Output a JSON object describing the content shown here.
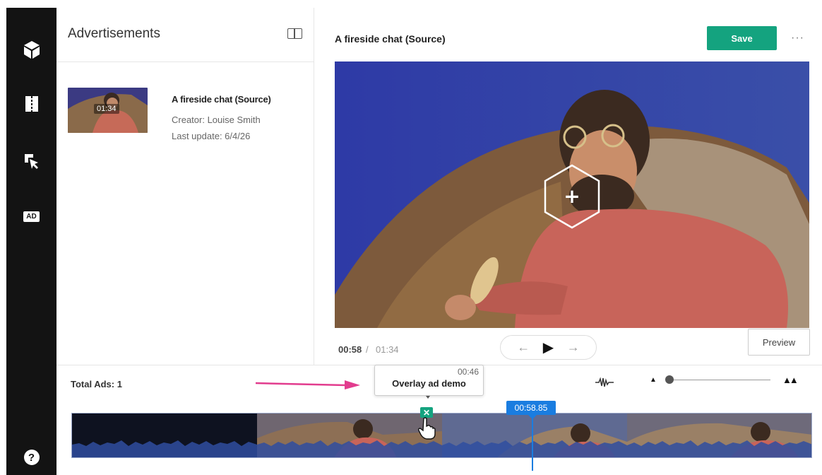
{
  "rail": {
    "ad_badge": "AD",
    "help": "?",
    "icons": [
      "cube-icon",
      "split-icon",
      "interactive-cursor-icon",
      "ad-icon",
      "help-icon"
    ]
  },
  "panel": {
    "title": "Advertisements",
    "card": {
      "thumb_duration": "01:34",
      "title": "A fireside chat (Source)",
      "creator": "Creator: Louise Smith",
      "last_update": "Last update: 6/4/26"
    }
  },
  "player": {
    "title": "A fireside chat (Source)",
    "save_label": "Save",
    "more": "···",
    "time_current": "00:58",
    "time_sep": "/",
    "time_total": "01:34",
    "preview_label": "Preview",
    "add_overlay": "+"
  },
  "timeline": {
    "total_ads": "Total Ads: 1",
    "tooltip_time": "00:46",
    "tooltip_label": "Overlay ad demo",
    "playhead": "00:58.85",
    "zoom_level": 0.02,
    "colors": {
      "accent": "#14a37f",
      "playhead": "#1a7de0",
      "annotation": "#e23c8e"
    }
  }
}
